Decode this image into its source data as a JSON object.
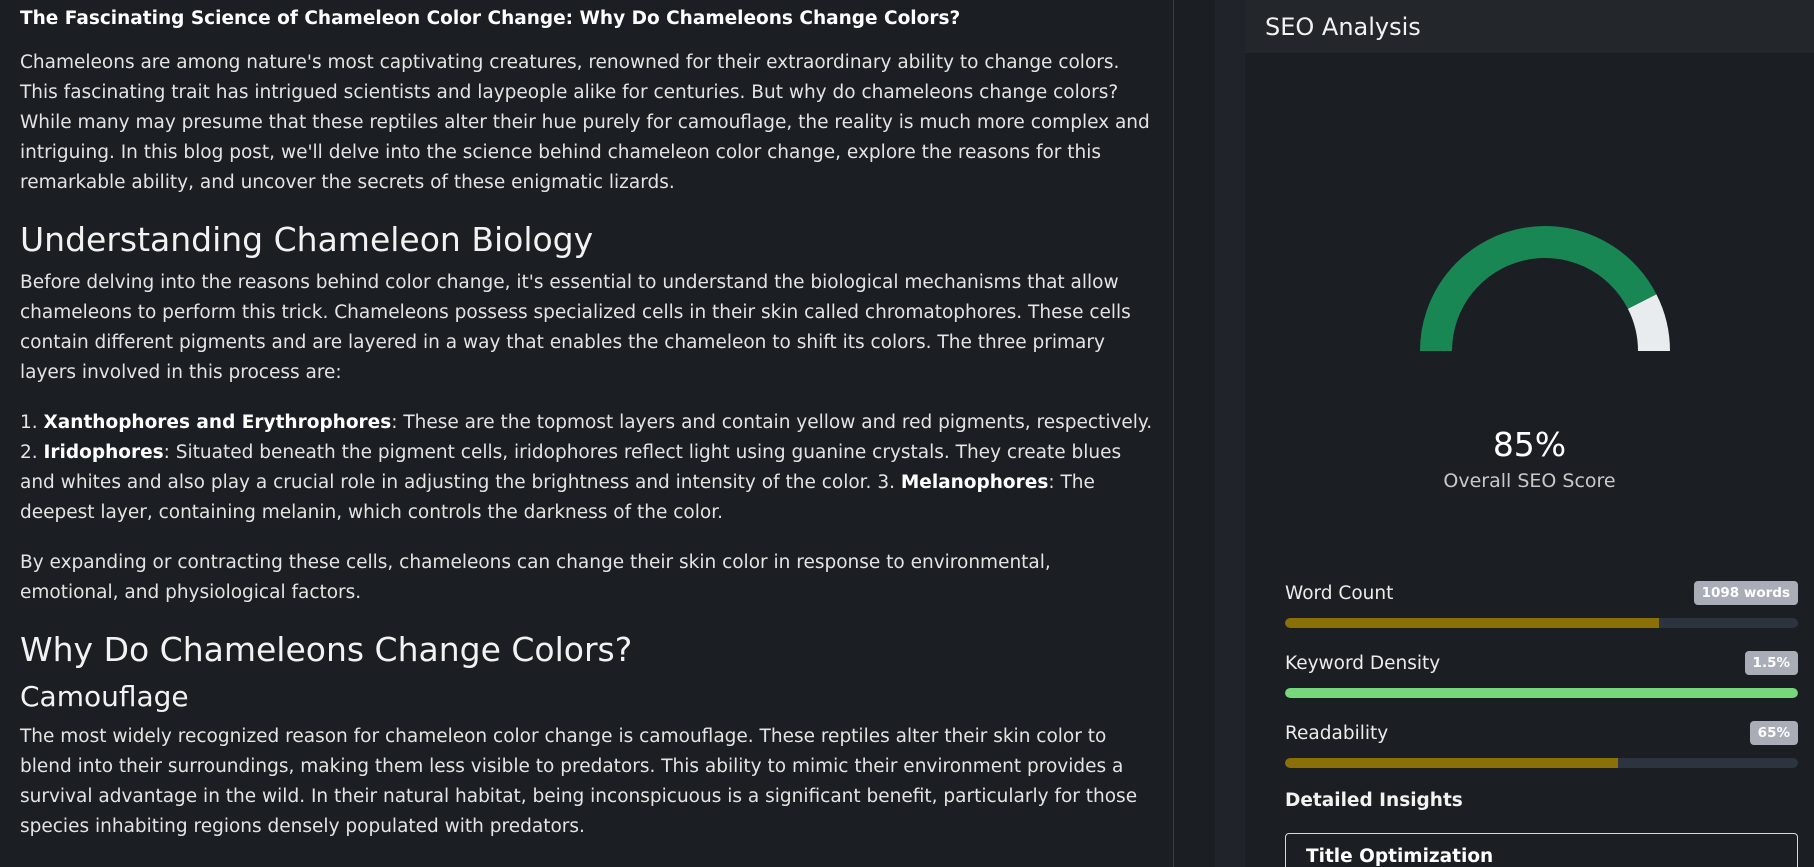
{
  "article": {
    "title": "The Fascinating Science of Chameleon Color Change: Why Do Chameleons Change Colors?",
    "intro": "Chameleons are among nature's most captivating creatures, renowned for their extraordinary ability to change colors. This fascinating trait has intrigued scientists and laypeople alike for centuries. But why do chameleons change colors? While many may presume that these reptiles alter their hue purely for camouflage, the reality is much more complex and intriguing. In this blog post, we'll delve into the science behind chameleon color change, explore the reasons for this remarkable ability, and uncover the secrets of these enigmatic lizards.",
    "h_biology": "Understanding Chameleon Biology",
    "p_biology": "Before delving into the reasons behind color change, it's essential to understand the biological mechanisms that allow chameleons to perform this trick. Chameleons possess specialized cells in their skin called chromatophores. These cells contain different pigments and are layered in a way that enables the chameleon to shift its colors. The three primary layers involved in this process are:",
    "list": {
      "n1": "1. ",
      "b1": "Xanthophores and Erythrophores",
      "t1": ": These are the topmost layers and contain yellow and red pigments, respectively. 2. ",
      "b2": "Iridophores",
      "t2": ": Situated beneath the pigment cells, iridophores reflect light using guanine crystals. They create blues and whites and also play a crucial role in adjusting the brightness and intensity of the color. 3. ",
      "b3": "Melanophores",
      "t3": ": The deepest layer, containing melanin, which controls the darkness of the color."
    },
    "p_expand": "By expanding or contracting these cells, chameleons can change their skin color in response to environmental, emotional, and physiological factors.",
    "h_why": "Why Do Chameleons Change Colors?",
    "h_camo": "Camouflage",
    "p_camo": "The most widely recognized reason for chameleon color change is camouflage. These reptiles alter their skin color to blend into their surroundings, making them less visible to predators. This ability to mimic their environment provides a survival advantage in the wild. In their natural habitat, being inconspicuous is a significant benefit, particularly for those species inhabiting regions densely populated with predators."
  },
  "seo": {
    "header": "SEO Analysis",
    "score": 0.85,
    "score_text": "85%",
    "score_label": "Overall SEO Score",
    "gauge_color": "#198754",
    "gauge_rest_color": "#e9ecef",
    "metrics": [
      {
        "name": "Word Count",
        "badge": "1098 words",
        "fraction": 0.73,
        "color": "#8a7007"
      },
      {
        "name": "Keyword Density",
        "badge": "1.5%",
        "fraction": 1.0,
        "color": "#75d87a"
      },
      {
        "name": "Readability",
        "badge": "65%",
        "fraction": 0.65,
        "color": "#8a7007"
      }
    ],
    "insights_title": "Detailed Insights",
    "insight_cards": [
      {
        "title": "Title Optimization"
      }
    ]
  }
}
